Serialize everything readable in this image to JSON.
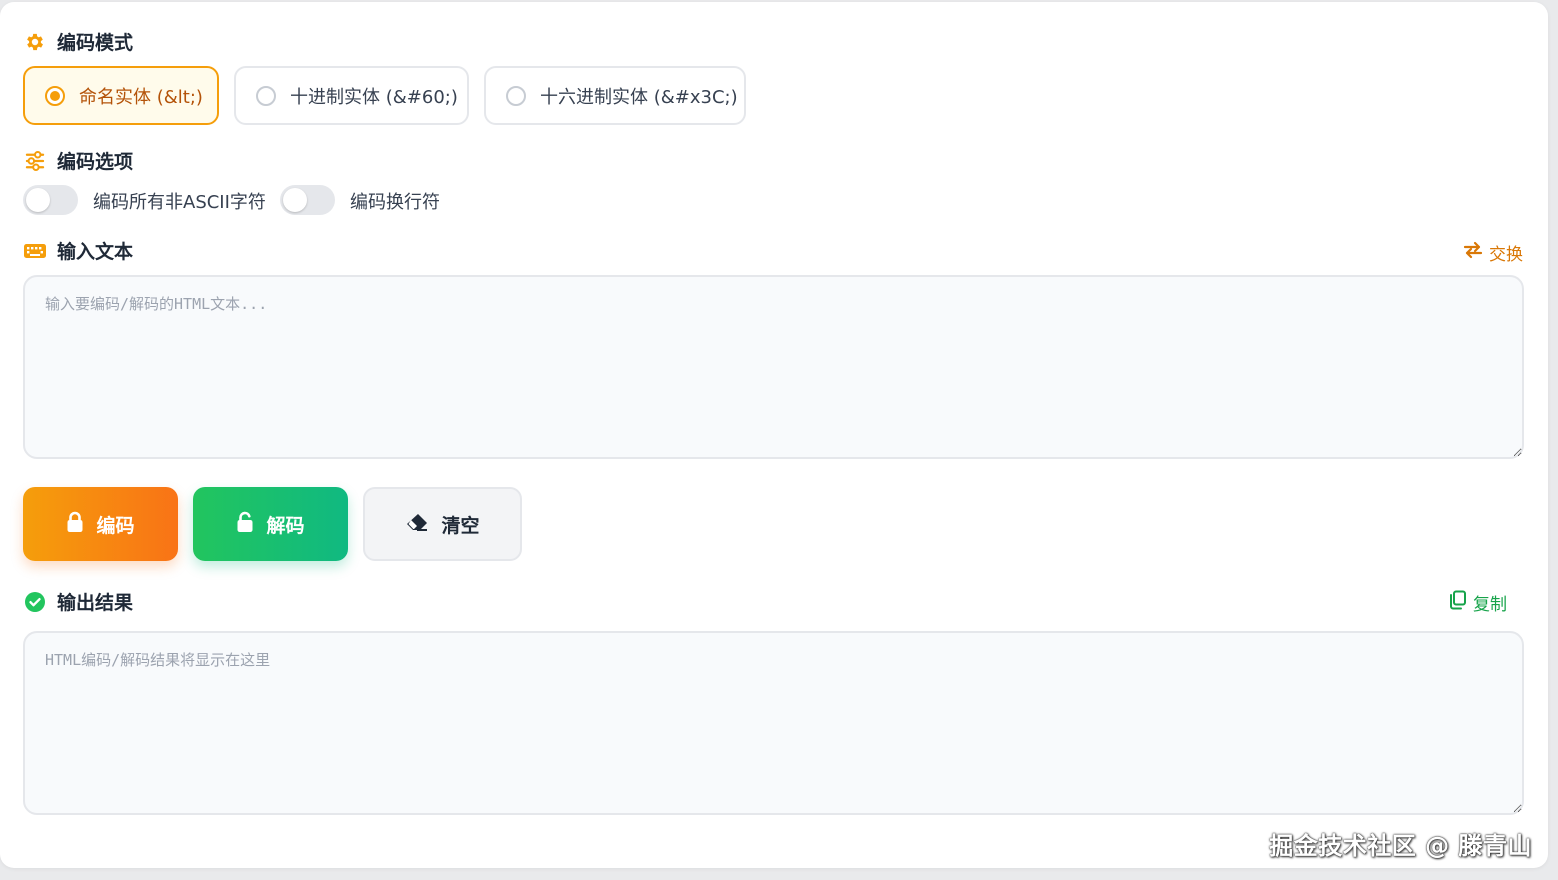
{
  "encoding_mode": {
    "title": "编码模式",
    "icon": "gear-icon",
    "options": [
      {
        "label": "命名实体 (&lt;)",
        "selected": true
      },
      {
        "label": "十进制实体 (&#60;)",
        "selected": false
      },
      {
        "label": "十六进制实体 (&#x3C;)",
        "selected": false
      }
    ]
  },
  "encoding_options": {
    "title": "编码选项",
    "icon": "sliders-icon",
    "toggles": [
      {
        "label": "编码所有非ASCII字符",
        "on": false
      },
      {
        "label": "编码换行符",
        "on": false
      }
    ]
  },
  "input": {
    "title": "输入文本",
    "icon": "keyboard-icon",
    "swap_label": "交换",
    "placeholder": "输入要编码/解码的HTML文本...",
    "value": ""
  },
  "actions": {
    "encode_label": "编码",
    "decode_label": "解码",
    "clear_label": "清空"
  },
  "output": {
    "title": "输出结果",
    "icon": "check-circle-icon",
    "copy_label": "复制",
    "placeholder": "HTML编码/解码结果将显示在这里",
    "value": ""
  },
  "watermark": "掘金技术社区 @ 滕青山",
  "colors": {
    "accent": "#f59e0b",
    "accent_dark": "#f97316",
    "success": "#22c55e",
    "swap_link": "#d97706",
    "copy_link": "#16a34a"
  }
}
